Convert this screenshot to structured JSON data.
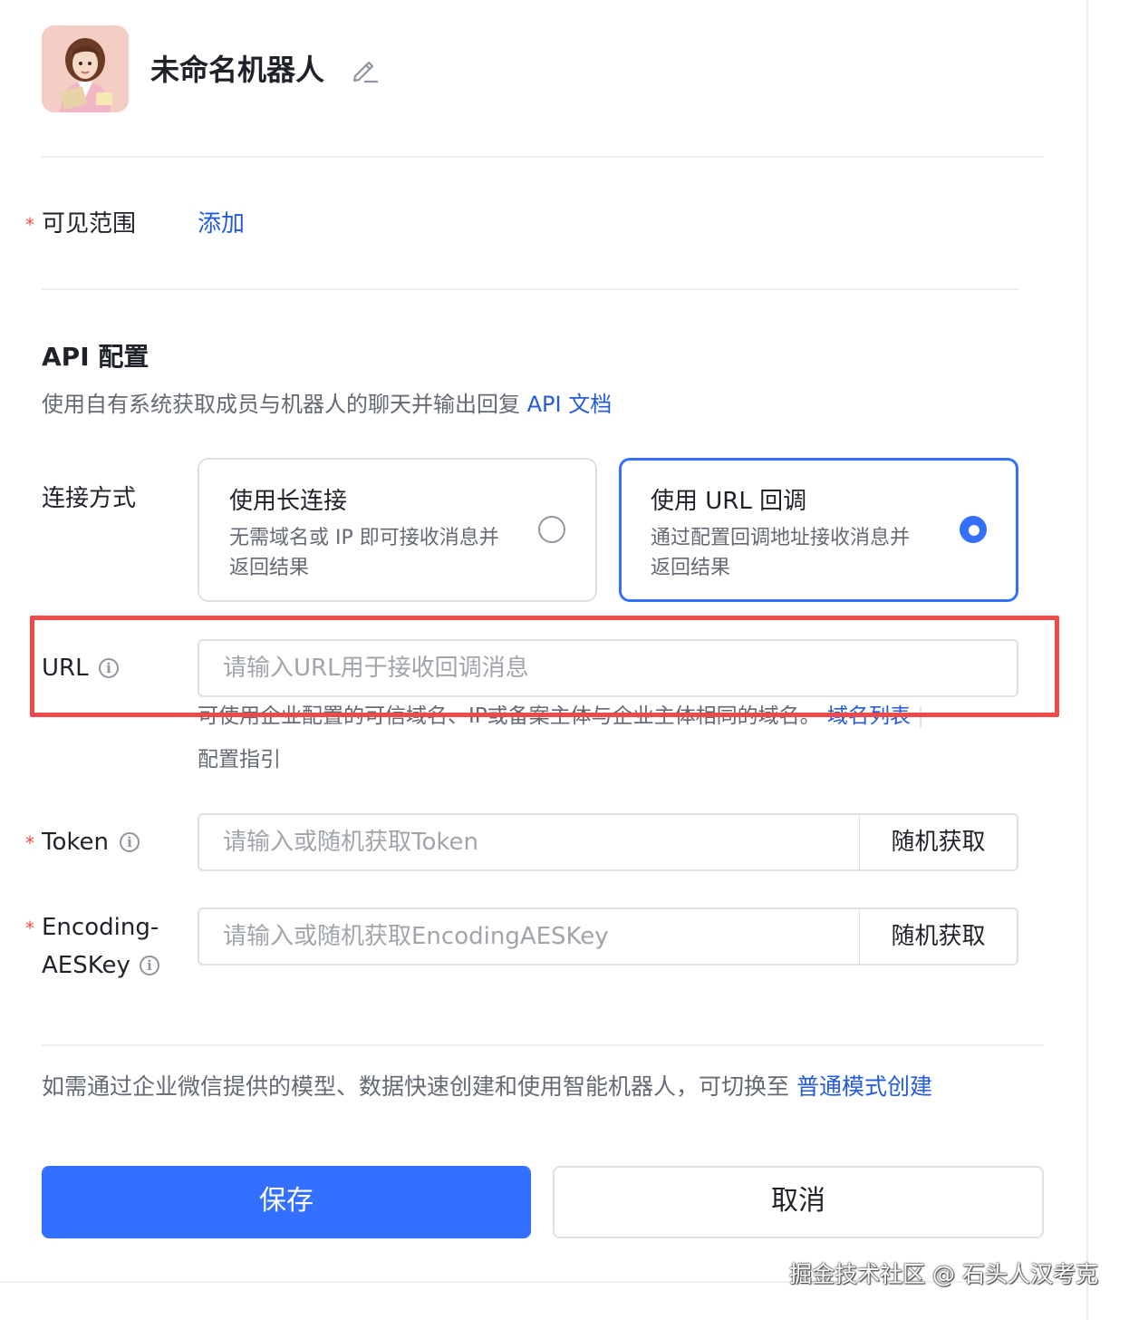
{
  "header": {
    "bot_name": "未命名机器人",
    "edit_icon": "pencil-icon"
  },
  "visibility": {
    "label": "可见范围",
    "add_link": "添加"
  },
  "api_section": {
    "title": "API 配置",
    "description": "使用自有系统获取成员与机器人的聊天并输出回复",
    "doc_link": "API 文档"
  },
  "connection": {
    "label": "连接方式",
    "options": [
      {
        "title": "使用长连接",
        "desc_line1": "无需域名或 IP 即可接收消息并",
        "desc_line2": "返回结果",
        "selected": false
      },
      {
        "title": "使用 URL 回调",
        "desc_line1": "通过配置回调地址接收消息并",
        "desc_line2": "返回结果",
        "selected": true
      }
    ]
  },
  "url_field": {
    "label": "URL",
    "placeholder": "请输入URL用于接收回调消息",
    "help_text": "可使用企业配置的可信域名、IP或备案主体与企业主体相同的域名。",
    "domain_list_link": "域名列表",
    "guide_link": "配置指引"
  },
  "token_field": {
    "label": "Token",
    "placeholder": "请输入或随机获取Token",
    "button": "随机获取"
  },
  "aes_field": {
    "label_line1": "Encoding-",
    "label_line2": "AESKey",
    "placeholder": "请输入或随机获取EncodingAESKey",
    "button": "随机获取"
  },
  "footer_note": {
    "text": "如需通过企业微信提供的模型、数据快速创建和使用智能机器人，可切换至",
    "link": "普通模式创建"
  },
  "actions": {
    "save": "保存",
    "cancel": "取消"
  },
  "watermark": "掘金技术社区 @ 石头人汉考克",
  "colors": {
    "accent": "#3370ff",
    "link": "#245bdb",
    "required": "#f54a45",
    "highlight": "#ef4a4a"
  }
}
